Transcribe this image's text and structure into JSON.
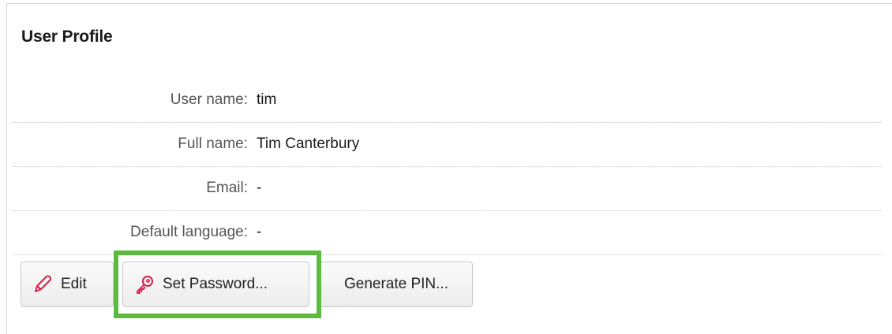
{
  "panel": {
    "title": "User Profile"
  },
  "fields": [
    {
      "label": "User name:",
      "value": "tim"
    },
    {
      "label": "Full name:",
      "value": "Tim Canterbury"
    },
    {
      "label": "Email:",
      "value": "-"
    },
    {
      "label": "Default language:",
      "value": "-"
    }
  ],
  "buttons": {
    "edit_label": "Edit",
    "edit_icon": "pencil-icon",
    "set_password_label": "Set Password...",
    "set_password_icon": "key-icon",
    "generate_pin_label": "Generate PIN..."
  },
  "colors": {
    "icon_accent": "#d6204a",
    "highlight": "#5cbb3f"
  }
}
